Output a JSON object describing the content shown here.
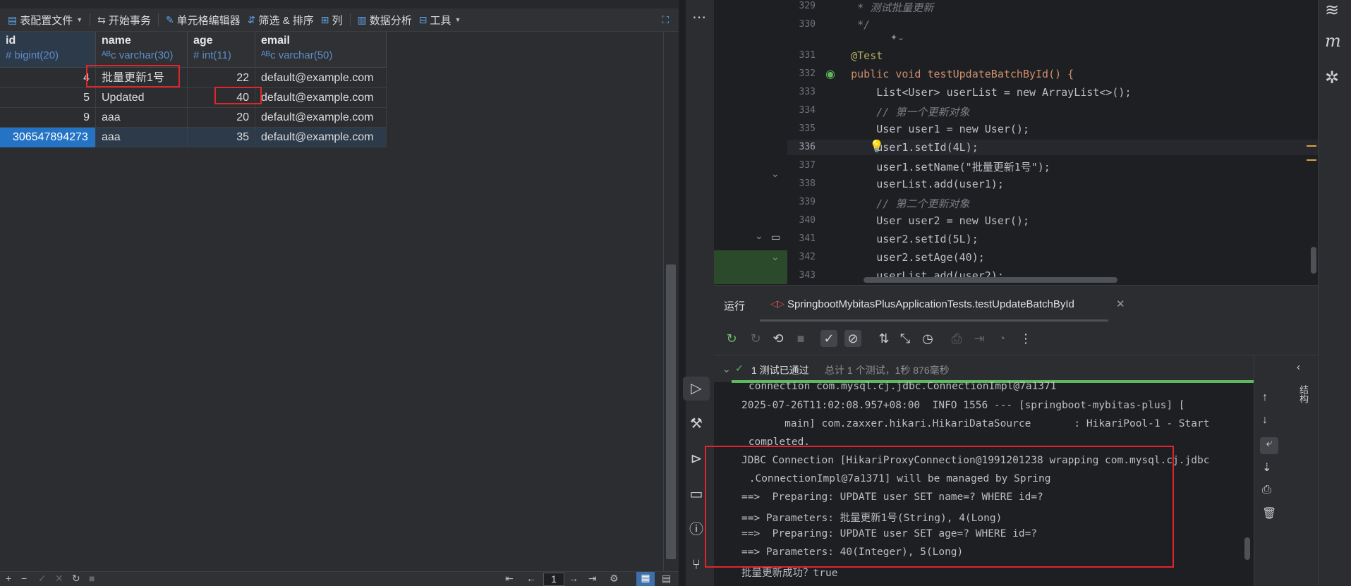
{
  "db": {
    "toolbar": {
      "config": "表配置文件",
      "transaction": "开始事务",
      "cell_editor": "单元格编辑器",
      "filter_sort": "筛选 & 排序",
      "columns": "列",
      "analysis": "数据分析",
      "tools": "工具"
    },
    "columns": [
      {
        "name": "id",
        "type": "bigint(20)"
      },
      {
        "name": "name",
        "type": "varchar(30)"
      },
      {
        "name": "age",
        "type": "int(11)"
      },
      {
        "name": "email",
        "type": "varchar(50)"
      }
    ],
    "rows": [
      {
        "id": "4",
        "name": "批量更新1号",
        "age": "22",
        "email": "default@example.com"
      },
      {
        "id": "5",
        "name": "Updated",
        "age": "40",
        "email": "default@example.com"
      },
      {
        "id": "9",
        "name": "aaa",
        "age": "20",
        "email": "default@example.com"
      },
      {
        "id": "306547894273",
        "name": "aaa",
        "age": "35",
        "email": "default@example.com"
      }
    ],
    "pager": {
      "page": "1"
    }
  },
  "editor": {
    "lines": [
      {
        "n": "329",
        "t": "     * 测试批量更新"
      },
      {
        "n": "330",
        "t": "     */"
      },
      {
        "n": "331",
        "t": "    @Test"
      },
      {
        "n": "332",
        "t": "    public void testUpdateBatchById() {"
      },
      {
        "n": "333",
        "t": "        List<User> userList = new ArrayList<>();"
      },
      {
        "n": "334",
        "t": "        // 第一个更新对象"
      },
      {
        "n": "335",
        "t": "        User user1 = new User();"
      },
      {
        "n": "336",
        "t": "        user1.setId(4L);"
      },
      {
        "n": "337",
        "t": "        user1.setName(\"批量更新1号\");"
      },
      {
        "n": "338",
        "t": "        userList.add(user1);"
      },
      {
        "n": "339",
        "t": "        // 第二个更新对象"
      },
      {
        "n": "340",
        "t": "        User user2 = new User();"
      },
      {
        "n": "341",
        "t": "        user2.setId(5L);"
      },
      {
        "n": "342",
        "t": "        user2.setAge(40);"
      },
      {
        "n": "343",
        "t": "        userList.add(user2);"
      }
    ]
  },
  "run": {
    "title": "运行",
    "tab": "SpringbootMybitasPlusApplicationTests.testUpdateBatchById",
    "status": "1 测试已通过",
    "summary": "总计 1 个测试，1秒 876毫秒",
    "console": [
      "connection com.mysql.cj.jdbc.ConnectionImpl@7a1371",
      "2025-07-26T11:02:08.957+08:00  INFO 1556 --- [springboot-mybitas-plus] [",
      "       main] com.zaxxer.hikari.HikariDataSource       : HikariPool-1 - Start",
      " completed.",
      "JDBC Connection [HikariProxyConnection@1991201238 wrapping com.mysql.cj.jdbc",
      " .ConnectionImpl@7a1371] will be managed by Spring",
      "==>  Preparing: UPDATE user SET name=? WHERE id=?",
      "==> Parameters: 批量更新1号(String), 4(Long)",
      "==>  Preparing: UPDATE user SET age=? WHERE id=?",
      "==> Parameters: 40(Integer), 5(Long)",
      "批量更新成功？true"
    ],
    "side_label": "结构"
  }
}
